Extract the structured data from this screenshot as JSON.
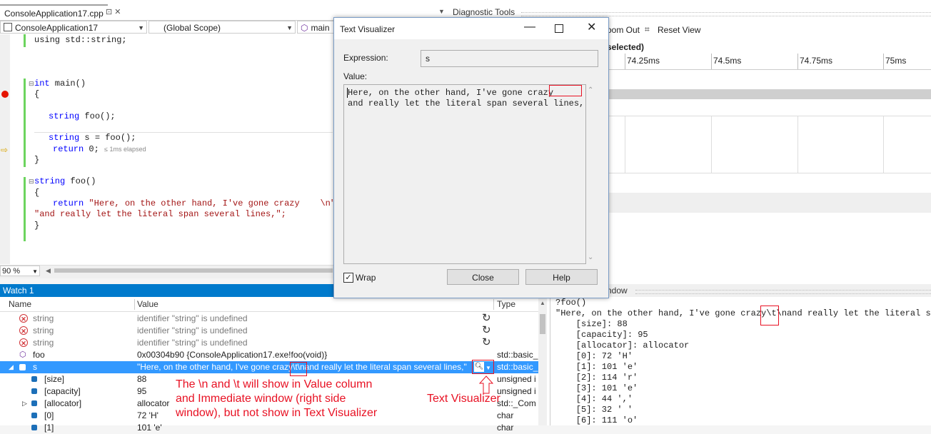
{
  "editor": {
    "file_tab": "ConsoleApplication17.cpp",
    "tab_icons": "⊡ ✕",
    "project_dropdown": "ConsoleApplication17",
    "scope_dropdown": "(Global Scope)",
    "member_dropdown": "main",
    "lines": {
      "using": "using std::string;",
      "main_sig_kw": "int",
      "main_sig_rest": " main()",
      "open1": "{",
      "decl_kw": "string",
      "decl_rest": " foo();",
      "assign_kw": "string",
      "assign_rest": " s = foo();",
      "ret_kw": "return",
      "ret_rest": " 0;",
      "elapsed_hint": "≤ 1ms elapsed",
      "close1": "}",
      "foo_sig_kw": "string",
      "foo_sig_rest": " foo()",
      "open2": "{",
      "foo_ret_kw": "return",
      "foo_ret_str1": "\"Here, on the other hand, I've gone crazy    \\n\"",
      "foo_ret_str2": "\"and really let the literal span several lines,\";",
      "close2": "}"
    },
    "zoom": "90 %"
  },
  "diagnostic": {
    "title": "Diagnostic Tools",
    "zoom_out": "oom Out",
    "reset_view": "Reset View",
    "selected_text": "selected)",
    "ticks": [
      "74.25ms",
      "74.5ms",
      "74.75ms",
      "75ms"
    ]
  },
  "dialog": {
    "title": "Text Visualizer",
    "expression_label": "Expression:",
    "expression_value": "s",
    "value_label": "Value:",
    "value_line1": "Here, on the other hand, I've gone crazy",
    "value_line2": "and really let the literal span several lines,",
    "wrap_label": "Wrap",
    "close_button": "Close",
    "help_button": "Help"
  },
  "watch": {
    "title": "Watch 1",
    "headers": {
      "name": "Name",
      "value": "Value",
      "type": "Type"
    },
    "rows": [
      {
        "name": "string",
        "value": "identifier \"string\" is undefined",
        "type": ""
      },
      {
        "name": "string",
        "value": "identifier \"string\" is undefined",
        "type": ""
      },
      {
        "name": "string",
        "value": "identifier \"string\" is undefined",
        "type": ""
      },
      {
        "name": "foo",
        "value": "0x00304b90 {ConsoleApplication17.exe!foo(void)}",
        "type": "std::basic_"
      },
      {
        "name": "s",
        "value": "\"Here, on the other hand, I've gone crazy\\t\\nand really let the literal span several lines,\"",
        "type": "std::basic_"
      },
      {
        "name": "[size]",
        "value": "88",
        "type": "unsigned i"
      },
      {
        "name": "[capacity]",
        "value": "95",
        "type": "unsigned i"
      },
      {
        "name": "[allocator]",
        "value": "allocator",
        "type": "std::_Com"
      },
      {
        "name": "[0]",
        "value": "72 'H'",
        "type": "char"
      },
      {
        "name": "[1]",
        "value": "101 'e'",
        "type": "char"
      }
    ]
  },
  "immediate": {
    "title": "ndow",
    "lines": [
      "?foo()",
      "\"Here, on the other hand, I've gone crazy\\t\\nand really let the literal span",
      "    [size]: 88",
      "    [capacity]: 95",
      "    [allocator]: allocator",
      "    [0]: 72 'H'",
      "    [1]: 101 'e'",
      "    [2]: 114 'r'",
      "    [3]: 101 'e'",
      "    [4]: 44 ','",
      "    [5]: 32 ' '",
      "    [6]: 111 'o'"
    ]
  },
  "annotations": {
    "note": "The \\n and \\t will show in Value column\nand Immediate window (right side\nwindow), but not show in Text Visualizer",
    "visualizer_label": "Text Visualizer",
    "color": "#e81123"
  }
}
